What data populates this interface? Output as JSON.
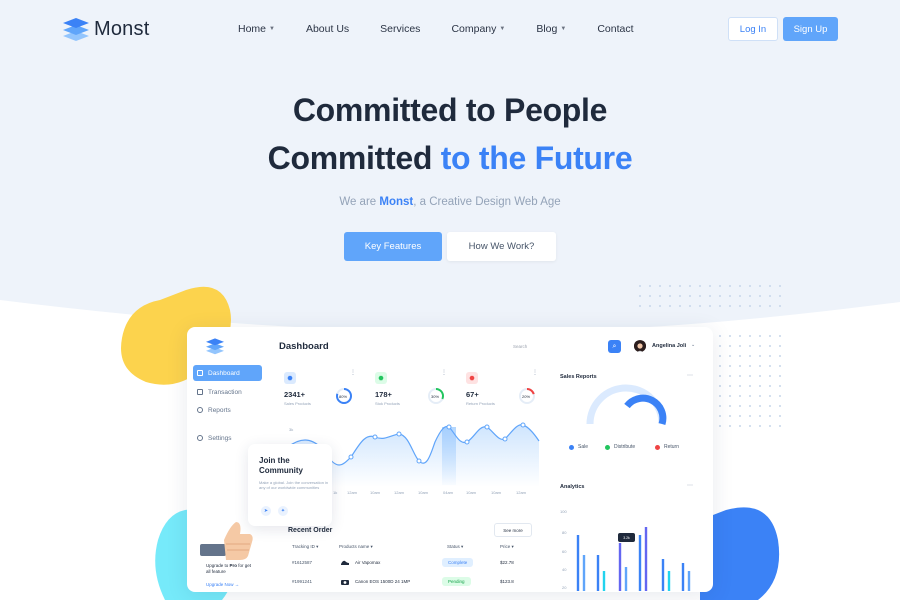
{
  "nav": {
    "brand": "Monst",
    "menu": [
      {
        "label": "Home",
        "dropdown": true
      },
      {
        "label": "About Us",
        "dropdown": false
      },
      {
        "label": "Services",
        "dropdown": false
      },
      {
        "label": "Company",
        "dropdown": true
      },
      {
        "label": "Blog",
        "dropdown": true
      },
      {
        "label": "Contact",
        "dropdown": false
      }
    ],
    "login": "Log In",
    "signup": "Sign Up"
  },
  "hero": {
    "line1": "Committed to People",
    "line2_plain": "Committed ",
    "line2_accent": "to the Future",
    "sub_pre": "We are ",
    "sub_brand": "Monst",
    "sub_post": ", a Creative Design Web Age",
    "btn_primary": "Key Features",
    "btn_secondary": "How We Work?"
  },
  "dashboard": {
    "title": "Dashboard",
    "search_placeholder": "Search",
    "user": "Angelina Joli",
    "sidebar": [
      {
        "label": "Dashboard",
        "active": true
      },
      {
        "label": "Transaction",
        "active": false
      },
      {
        "label": "Reports",
        "active": false
      },
      {
        "label": "Settings",
        "active": false
      }
    ],
    "stats": [
      {
        "value": "2341+",
        "label": "Sales Products",
        "percent": "80%",
        "color": "#3b82f6"
      },
      {
        "value": "178+",
        "label": "Stok Products",
        "percent": "30%",
        "color": "#22c55e"
      },
      {
        "value": "67+",
        "label": "Return Products",
        "percent": "20%",
        "color": "#ef4444"
      }
    ],
    "line_chart": {
      "y_label": "3k",
      "x_labels": [
        "1k",
        "12am",
        "10am",
        "12am",
        "10am",
        "04am",
        "10am",
        "10am",
        "12am"
      ]
    },
    "sales_reports": {
      "title": "Sales Reports",
      "legend": [
        {
          "label": "Sale",
          "color": "#3b82f6"
        },
        {
          "label": "Distribute",
          "color": "#22c55e"
        },
        {
          "label": "Return",
          "color": "#ef4444"
        }
      ]
    },
    "analytics": {
      "title": "Analytics",
      "y_ticks": [
        "100",
        "80",
        "60",
        "40",
        "20"
      ],
      "tooltip": "3.2k"
    },
    "community": {
      "title": "Join the Community",
      "text": "Make a global. Join the conversation in any of our worldwide communities"
    },
    "upgrade": {
      "text_pre": "Upgrade to ",
      "text_bold": "Pro",
      "text_post": " for get all feature",
      "link": "Upgrade Now"
    },
    "orders": {
      "title": "Recent Order",
      "see_more": "See more",
      "headers": [
        "Tracking ID",
        "Products name",
        "Status",
        "Price"
      ],
      "rows": [
        {
          "id": "#1612587",
          "product": "Air Vapomax",
          "status": "Complete",
          "price": "$22.78"
        },
        {
          "id": "#1991241",
          "product": "Canon EOS 1500D 24 1MP",
          "status": "Pending",
          "price": "$123.8"
        }
      ]
    }
  }
}
